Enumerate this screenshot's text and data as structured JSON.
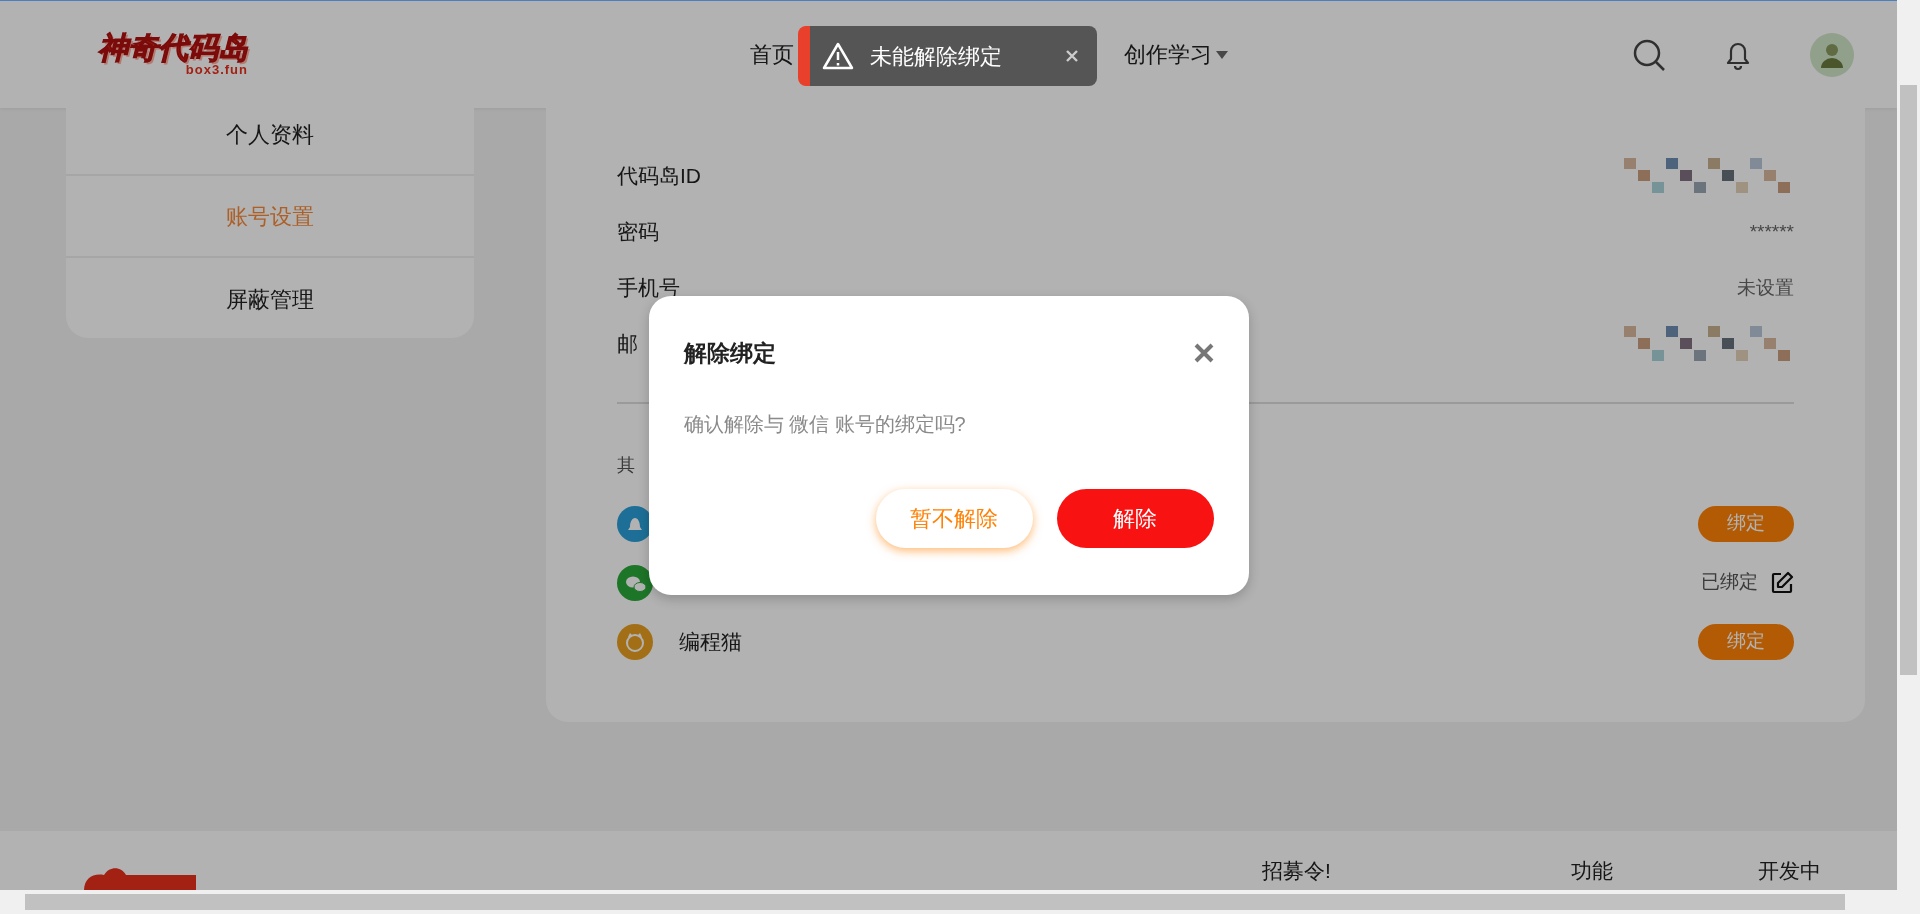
{
  "header": {
    "logo": {
      "title": "神奇代码岛",
      "subtitle": "box3.fun"
    },
    "nav": [
      {
        "label": "首页",
        "selected": false,
        "dropdown": false
      },
      {
        "label": "创作学习",
        "selected": false,
        "dropdown": true
      }
    ]
  },
  "toast": {
    "kind": "warning",
    "message": "未能解除绑定"
  },
  "sidebar": {
    "items": [
      {
        "label": "个人资料",
        "selected": false
      },
      {
        "label": "账号设置",
        "selected": true
      },
      {
        "label": "屏蔽管理",
        "selected": false
      }
    ]
  },
  "account": {
    "fields": [
      {
        "label": "代码岛ID",
        "kind": "pixelated"
      },
      {
        "label": "密码",
        "kind": "text",
        "value": "******"
      },
      {
        "label": "手机号",
        "kind": "text",
        "value": "未设置"
      },
      {
        "label": "邮",
        "kind": "pixelated"
      }
    ],
    "section_label": "其",
    "bindings": [
      {
        "kind": "qq",
        "bound": false,
        "action": "绑定"
      },
      {
        "kind": "wechat",
        "bound": true,
        "status": "已绑定"
      },
      {
        "kind": "codemao",
        "name": "编程猫",
        "bound": false,
        "action": "绑定"
      }
    ]
  },
  "dialog": {
    "title": "解除绑定",
    "message": "确认解除与 微信 账号的绑定吗?",
    "buttons": [
      {
        "label": "暂不解除",
        "kind": "secondary"
      },
      {
        "label": "解除",
        "kind": "primary"
      }
    ]
  },
  "footer": {
    "links": [
      "招募令!",
      "功能",
      "开发中"
    ]
  }
}
